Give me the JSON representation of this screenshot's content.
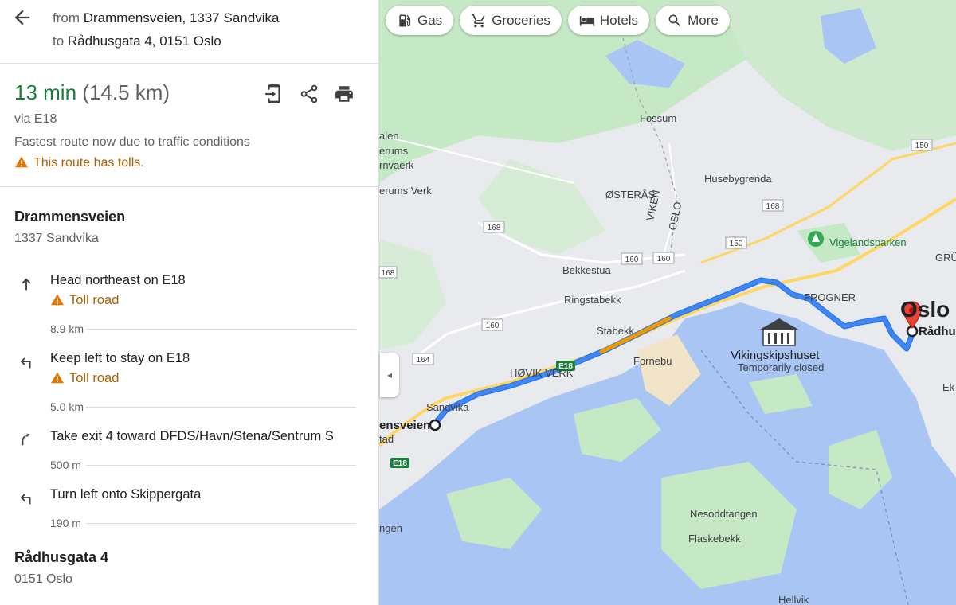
{
  "header": {
    "from_prefix": "from",
    "from_place": "Drammensveien, 1337 Sandvika",
    "to_prefix": "to",
    "to_place": "Rådhusgata 4, 0151 Oslo"
  },
  "summary": {
    "time": "13 min",
    "distance": "(14.5 km)",
    "via": "via E18",
    "note": "Fastest route now due to traffic conditions",
    "toll_warning": "This route has tolls."
  },
  "start": {
    "title": "Drammensveien",
    "subtitle": "1337 Sandvika"
  },
  "steps": [
    {
      "text": "Head northeast on E18",
      "toll": "Toll road",
      "distance": "8.9 km"
    },
    {
      "text": "Keep left to stay on E18",
      "toll": "Toll road",
      "distance": "5.0 km"
    },
    {
      "text": "Take exit 4 toward DFDS/Havn/Stena/Sentrum S",
      "distance": "500 m"
    },
    {
      "text": "Turn left onto Skippergata",
      "distance": "190 m"
    }
  ],
  "end": {
    "title": "Rådhusgata 4",
    "subtitle": "0151 Oslo"
  },
  "chips": [
    "Gas",
    "Groceries",
    "Hotels",
    "More"
  ],
  "colors": {
    "route": "#4285f4",
    "toll_segment": "#f29900",
    "water": "#a9c5f4",
    "land": "#e8eaed",
    "park": "#c5e8c5",
    "highway": "#fdd663",
    "time_green": "#188038",
    "warning": "#b06000"
  },
  "map": {
    "labels": {
      "fossum": "Fossum",
      "husebygrenda": "Husebygrenda",
      "osteras": "ØSTERÅS",
      "viken": "VIKEN",
      "oslo_border": "OSLO",
      "vigelandsparken": "Vigelandsparken",
      "bekkestua": "Bekkestua",
      "ringstabekk": "Ringstabekk",
      "stabekk": "Stabekk",
      "fornebu": "Fornebu",
      "frogner": "FROGNER",
      "oslo": "Oslo",
      "radhus": "Rådhus",
      "gru": "GRÜ",
      "vikingskipshuset": "Vikingskipshuset",
      "temp_closed": "Temporarily closed",
      "hovik_verk": "HØVIK VERK",
      "sandvika": "Sandvika",
      "ensveien": "ensveien",
      "tad": "tad",
      "ngen": "ngen",
      "nesoddtangen": "Nesoddtangen",
      "flaskebekk": "Flaskebekk",
      "hellvik": "Hellvik",
      "ek": "Ek",
      "alen": "alen",
      "erums": "erums",
      "rnvaerk": "rnvaerk",
      "erums_verk": "erums Verk"
    },
    "road_badges": [
      "150",
      "168",
      "168",
      "168",
      "160",
      "160",
      "160",
      "150",
      "164",
      "E18",
      "E18"
    ]
  }
}
